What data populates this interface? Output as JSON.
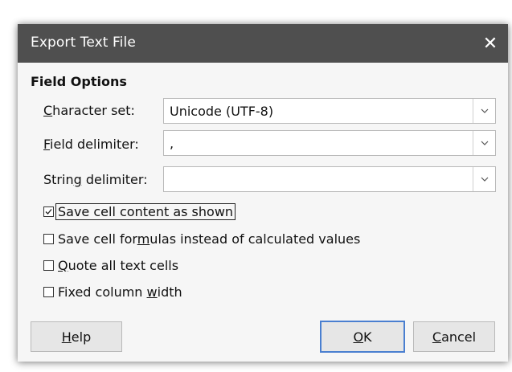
{
  "dialog": {
    "title": "Export Text File",
    "close_glyph": "✕"
  },
  "field_options": {
    "section_title": "Field Options",
    "character_set": {
      "label_prefix": "",
      "label_mnemonic": "C",
      "label_rest": "haracter set:",
      "value": "Unicode (UTF-8)"
    },
    "field_delimiter": {
      "label_prefix": "",
      "label_mnemonic": "F",
      "label_rest": "ield delimiter:",
      "value": ","
    },
    "string_delimiter": {
      "label_prefix": "Strin",
      "label_mnemonic": "g",
      "label_rest": " delimiter:",
      "value": ""
    }
  },
  "checkboxes": [
    {
      "pre": "Save cell content as shown",
      "mn": "",
      "post": "",
      "checked": true
    },
    {
      "pre": "Save cell for",
      "mn": "m",
      "post": "ulas instead of calculated values",
      "checked": false
    },
    {
      "pre": "",
      "mn": "Q",
      "post": "uote all text cells",
      "checked": false
    },
    {
      "pre": "Fixed column ",
      "mn": "w",
      "post": "idth",
      "checked": false
    }
  ],
  "buttons": {
    "help": {
      "mn": "H",
      "rest": "elp"
    },
    "ok": {
      "mn": "O",
      "rest": "K"
    },
    "cancel": {
      "mn": "C",
      "rest": "ancel"
    }
  },
  "colors": {
    "titlebar": "#4f4f4f",
    "dialog_bg": "#f6f6f6",
    "default_button_border": "#4a7fd0"
  }
}
